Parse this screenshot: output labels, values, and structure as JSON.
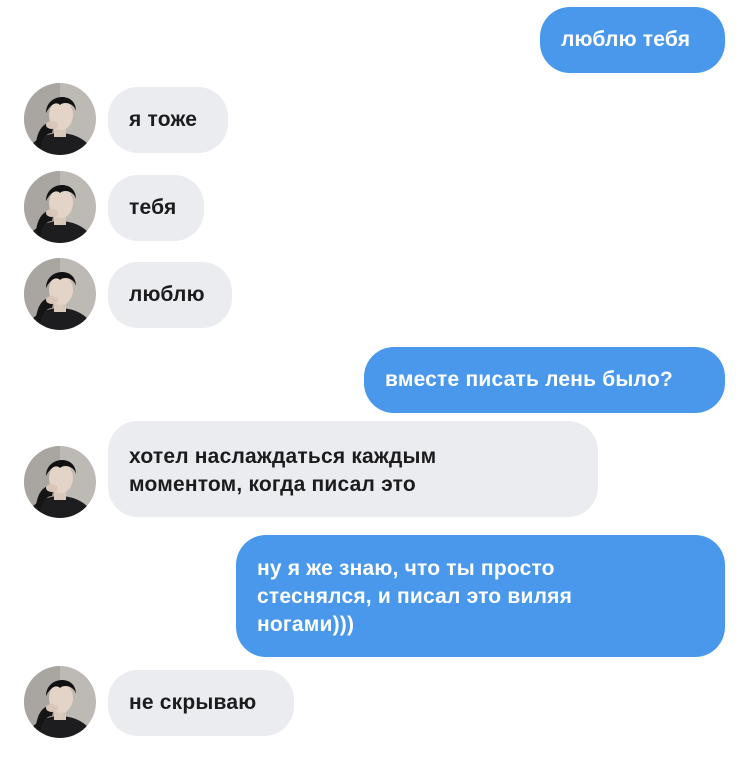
{
  "messages": [
    {
      "side": "out",
      "text": "люблю тебя"
    },
    {
      "side": "in",
      "text": "я тоже"
    },
    {
      "side": "in",
      "text": "тебя"
    },
    {
      "side": "in",
      "text": "люблю"
    },
    {
      "side": "out",
      "text": "вместе писать лень было?"
    },
    {
      "side": "in",
      "text": "хотел наслаждаться каждым\nмоментом, когда писал это"
    },
    {
      "side": "out",
      "text": "ну я же знаю, что ты просто\nстеснялся, и писал это виляя\nногами)))"
    },
    {
      "side": "in",
      "text": "не скрываю"
    }
  ],
  "colors": {
    "outgoing_bubble": "#4a98ec",
    "incoming_bubble": "#eaecf0",
    "outgoing_text": "#ffffff",
    "incoming_text": "#1c1c1e"
  },
  "avatar": {
    "icon": "contact-avatar-photo"
  }
}
